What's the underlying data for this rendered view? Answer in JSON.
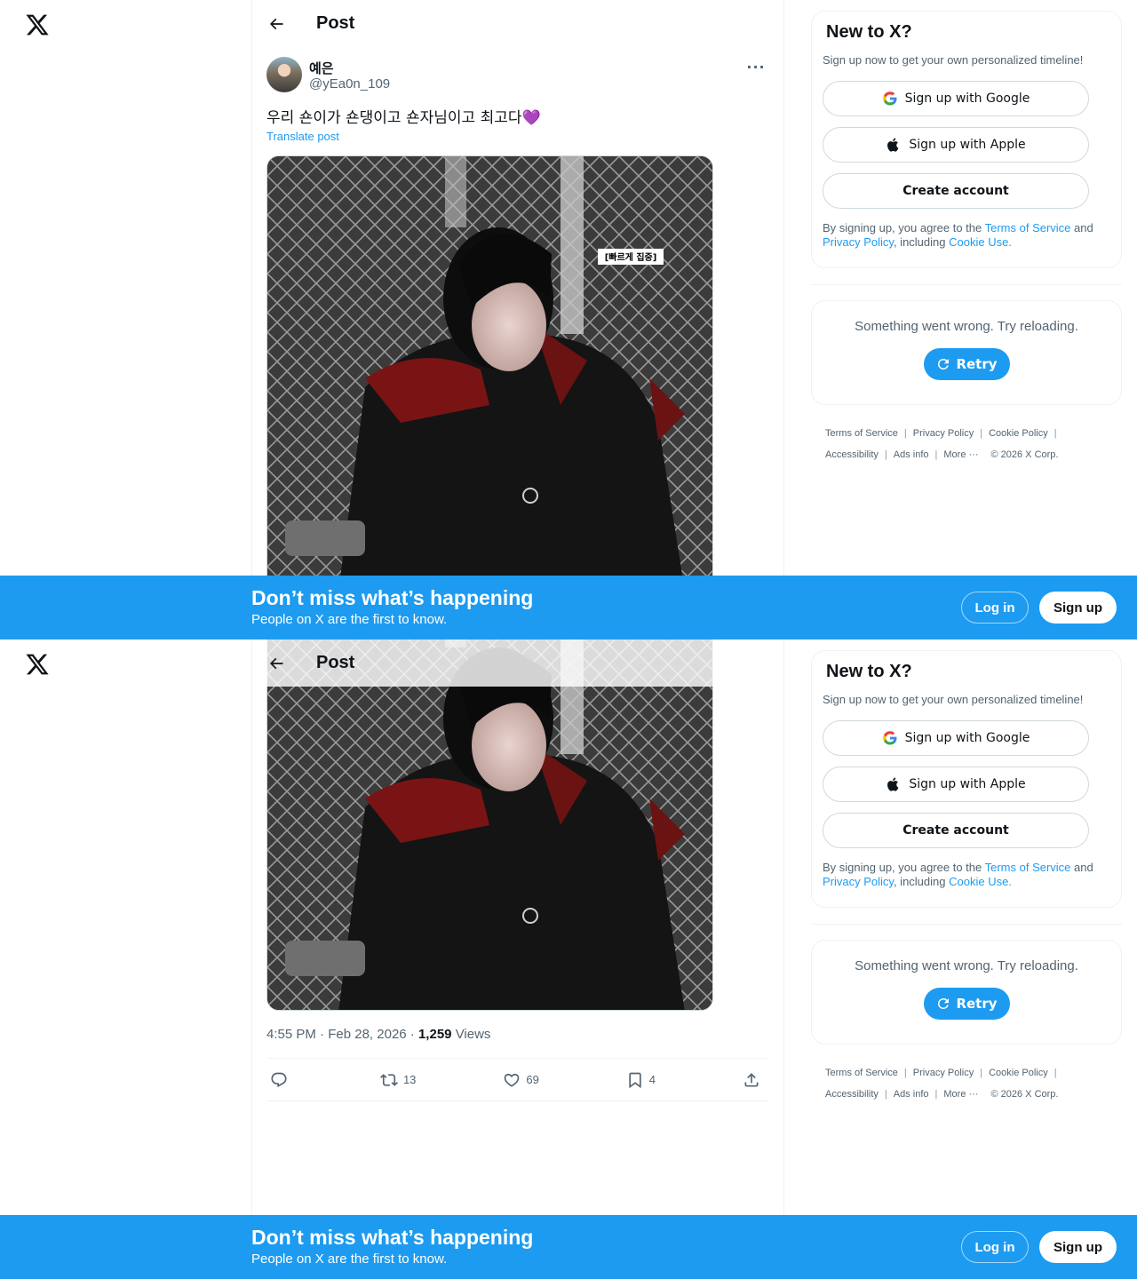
{
  "header": {
    "title": "Post",
    "back_icon": "arrow-left-icon",
    "logo_icon": "x-logo-icon"
  },
  "post": {
    "author_name": "예은",
    "author_handle": "@yEa0n_109",
    "text": "우리 숀이가 숀댕이고 숀자님이고 최고다",
    "emoji": "💜",
    "translate_label": "Translate post",
    "image_caption_tag": "[빠르게 집중]",
    "time": "4:55 PM",
    "date": "Feb 28, 2026",
    "views_count": "1,259",
    "views_label": "Views",
    "separator": " · "
  },
  "actions": {
    "reply_icon": "reply-icon",
    "reposts": "13",
    "likes": "69",
    "bookmarks": "4",
    "share_icon": "share-icon"
  },
  "sidebar": {
    "signup_title": "New to X?",
    "signup_subtitle": "Sign up now to get your own personalized timeline!",
    "google_label": "Sign up with Google",
    "apple_label": "Sign up with Apple",
    "create_label": "Create account",
    "terms_prefix": "By signing up, you agree to the ",
    "terms_link": "Terms of Service",
    "terms_and": " and ",
    "privacy_link": "Privacy Policy",
    "including": ", including ",
    "cookie_link": "Cookie Use.",
    "error_message": "Something went wrong. Try reloading.",
    "retry_label": "Retry"
  },
  "footer": {
    "terms": "Terms of Service",
    "privacy": "Privacy Policy",
    "cookie": "Cookie Policy",
    "accessibility": "Accessibility",
    "ads": "Ads info",
    "more": "More ···",
    "copyright": "© 2026 X Corp.",
    "sep": "|"
  },
  "banner": {
    "title": "Don’t miss what’s happening",
    "subtitle": "People on X are the first to know.",
    "login_label": "Log in",
    "signup_label": "Sign up"
  },
  "colors": {
    "accent": "#1d9bf0",
    "text": "#0f1419",
    "secondary": "#536471",
    "border": "#eff3f4"
  }
}
